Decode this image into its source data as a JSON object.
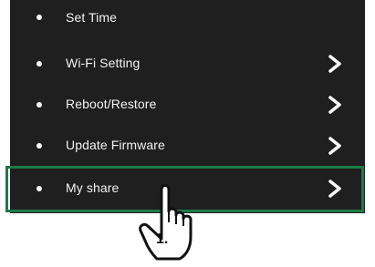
{
  "menu": {
    "items": [
      {
        "label": "Set Time",
        "has_arrow": false
      },
      {
        "label": "Wi-Fi Setting",
        "has_arrow": true
      },
      {
        "label": "Reboot/Restore",
        "has_arrow": true
      },
      {
        "label": "Update Firmware",
        "has_arrow": true
      },
      {
        "label": "My share",
        "has_arrow": true
      }
    ]
  },
  "annotation": {
    "step_label": "1.",
    "highlight_color": "#1e7a4a",
    "pointer_icon": "pointing-hand-icon"
  },
  "colors": {
    "panel_background": "#1f1f1f",
    "text": "#ffffff"
  }
}
